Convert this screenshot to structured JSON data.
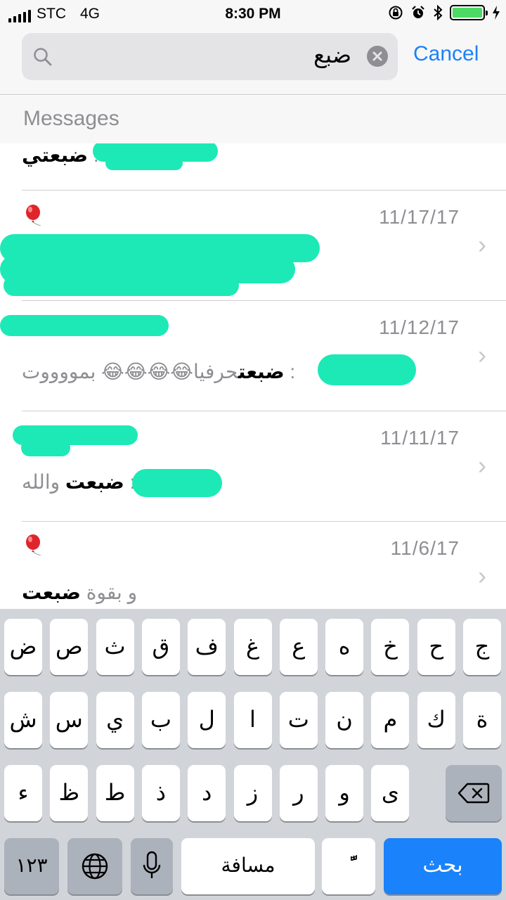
{
  "status_bar": {
    "carrier": "STC",
    "network": "4G",
    "time": "8:30 PM",
    "battery_level": 1.0,
    "colors": {
      "battery": "#4cd964"
    }
  },
  "search": {
    "query": "ضبع",
    "cancel_label": "Cancel"
  },
  "section": {
    "title": "Messages"
  },
  "results": [
    {
      "date": "",
      "text_bold": "ضبعتي",
      "text_after": " :",
      "has_balloon": false
    },
    {
      "date": "11/17/17",
      "text_before": "",
      "text_bold": "",
      "text_after": "",
      "has_balloon": true
    },
    {
      "date": "11/12/17",
      "text_before": "بمووووت :",
      "emojis": "😂😂😂😂",
      "text_bold": "ضبعت",
      "text_after": "حرفيا",
      "has_balloon": false
    },
    {
      "date": "11/11/17",
      "text_before": "والله :",
      "text_bold": "ضبعت",
      "has_balloon": false
    },
    {
      "date": "11/6/17",
      "text_bold": "ضبعت",
      "text_after": "و بقوة",
      "has_balloon": true
    }
  ],
  "keyboard": {
    "row1": [
      "ج",
      "ح",
      "خ",
      "ه",
      "ع",
      "غ",
      "ف",
      "ق",
      "ث",
      "ص",
      "ض"
    ],
    "row2": [
      "ة",
      "ك",
      "م",
      "ن",
      "ت",
      "ا",
      "ل",
      "ب",
      "ي",
      "س",
      "ش"
    ],
    "row3": [
      "ى",
      "و",
      "ر",
      "ز",
      "د",
      "ذ",
      "ط",
      "ظ",
      "ء"
    ],
    "numbers_label": "١٢٣",
    "space_label": "مسافة",
    "search_label": "بحث",
    "tashkeel_label": "ًّ"
  },
  "colors": {
    "accent": "#1a82fb",
    "redaction": "#1de9b6"
  }
}
